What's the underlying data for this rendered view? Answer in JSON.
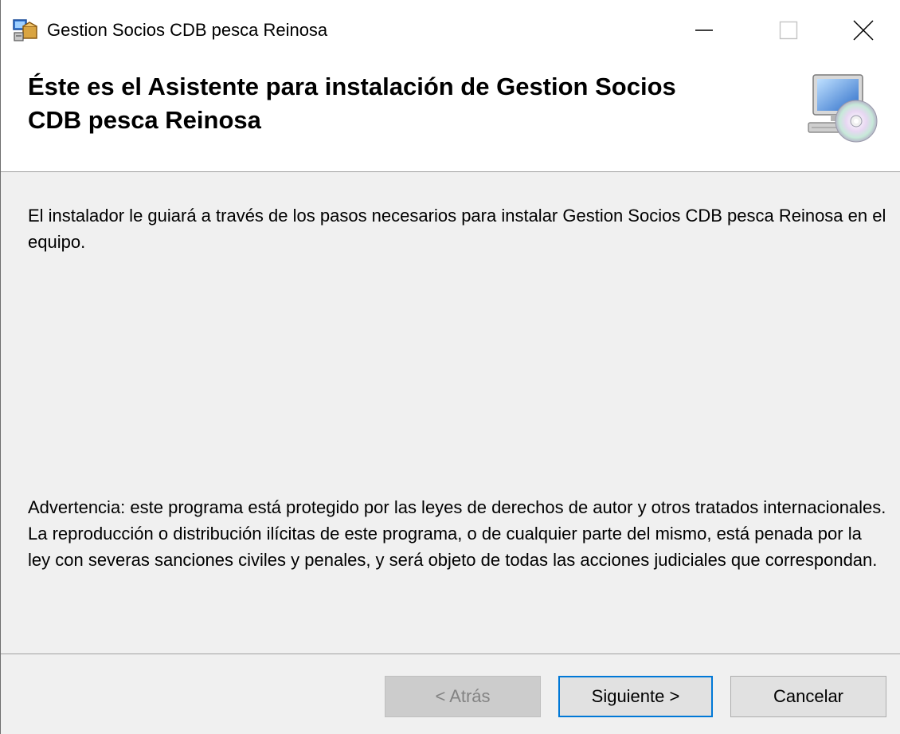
{
  "window": {
    "title": "Gestion Socios CDB pesca Reinosa",
    "app_icon": "installer-icon",
    "controls": {
      "minimize_icon": "minimize-icon",
      "maximize_icon": "maximize-icon",
      "close_icon": "close-icon"
    }
  },
  "header": {
    "title": "Éste es el Asistente para instalación de Gestion Socios CDB pesca Reinosa",
    "icon": "computer-cd-icon"
  },
  "body": {
    "intro": "El instalador le guiará a través de los pasos necesarios para instalar Gestion Socios CDB pesca Reinosa en el equipo.",
    "warning": "Advertencia: este programa está protegido por las leyes de derechos de autor y otros tratados internacionales. La reproducción o distribución ilícitas de este programa, o de cualquier parte del mismo, está penada por la ley con severas sanciones civiles y penales, y será objeto de todas las acciones judiciales que correspondan."
  },
  "buttons": {
    "back_label": "< Atrás",
    "back_disabled": true,
    "next_label": "Siguiente >",
    "cancel_label": "Cancelar"
  },
  "colors": {
    "accent": "#0078d7",
    "dialog_background": "#f0f0f0",
    "header_background": "#ffffff"
  }
}
